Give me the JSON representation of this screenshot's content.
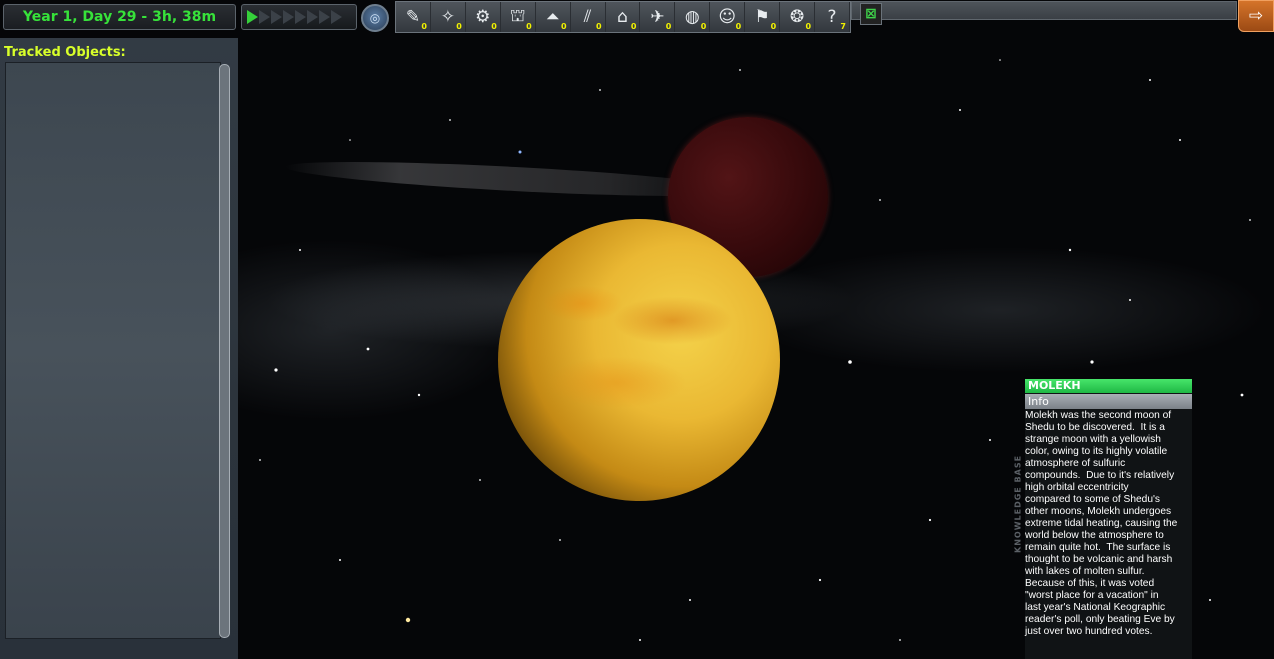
{
  "clock": {
    "text": "Year 1, Day 29 - 3h, 38m"
  },
  "time_warp": {
    "levels": 8,
    "active_levels": 1
  },
  "filters": [
    {
      "name": "debris",
      "icon": "debris-icon",
      "glyph": "✎",
      "count": "0"
    },
    {
      "name": "probes",
      "icon": "probe-icon",
      "glyph": "✧",
      "count": "0"
    },
    {
      "name": "rovers",
      "icon": "rover-icon",
      "glyph": "⚙",
      "count": "0"
    },
    {
      "name": "landers",
      "icon": "lander-icon",
      "glyph": "⛫",
      "count": "0"
    },
    {
      "name": "ships",
      "icon": "ship-icon",
      "glyph": "⏶",
      "count": "0"
    },
    {
      "name": "stations",
      "icon": "station-icon",
      "glyph": "⫽",
      "count": "0"
    },
    {
      "name": "bases",
      "icon": "base-icon",
      "glyph": "⌂",
      "count": "0"
    },
    {
      "name": "planes",
      "icon": "plane-icon",
      "glyph": "✈",
      "count": "0"
    },
    {
      "name": "relays",
      "icon": "relay-icon",
      "glyph": "◍",
      "count": "0"
    },
    {
      "name": "eva",
      "icon": "eva-icon",
      "glyph": "☺",
      "count": "0"
    },
    {
      "name": "flags",
      "icon": "flag-icon",
      "glyph": "⚑",
      "count": "0"
    },
    {
      "name": "asteroids",
      "icon": "asteroid-icon",
      "glyph": "❂",
      "count": "0"
    },
    {
      "name": "unknown",
      "icon": "unknown-object-icon",
      "glyph": "?",
      "count": "7"
    }
  ],
  "tracked_panel": {
    "title": "Tracked Objects:"
  },
  "knowledge_base": {
    "side_label": "KNOWLEDGE BASE",
    "title": "MOLEKH",
    "tab": "Info",
    "text": "Molekh was the second moon of\nShedu to be discovered.  It is a\nstrange moon with a yellowish\ncolor, owing to its highly volatile\natmosphere of sulfuric\ncompounds.  Due to it's relatively\nhigh orbital eccentricity\ncompared to some of Shedu's\nother moons, Molekh undergoes\nextreme tidal heating, causing the\nworld below the atmosphere to\nremain quite hot.  The surface is\nthought to be volcanic and harsh\nwith lakes of molten sulfur.\nBecause of this, it was voted\n\"worst place for a vacation\" in\nlast year's National Keographic\nreader's poll, only beating Eve by\njust over two hundred votes."
  }
}
